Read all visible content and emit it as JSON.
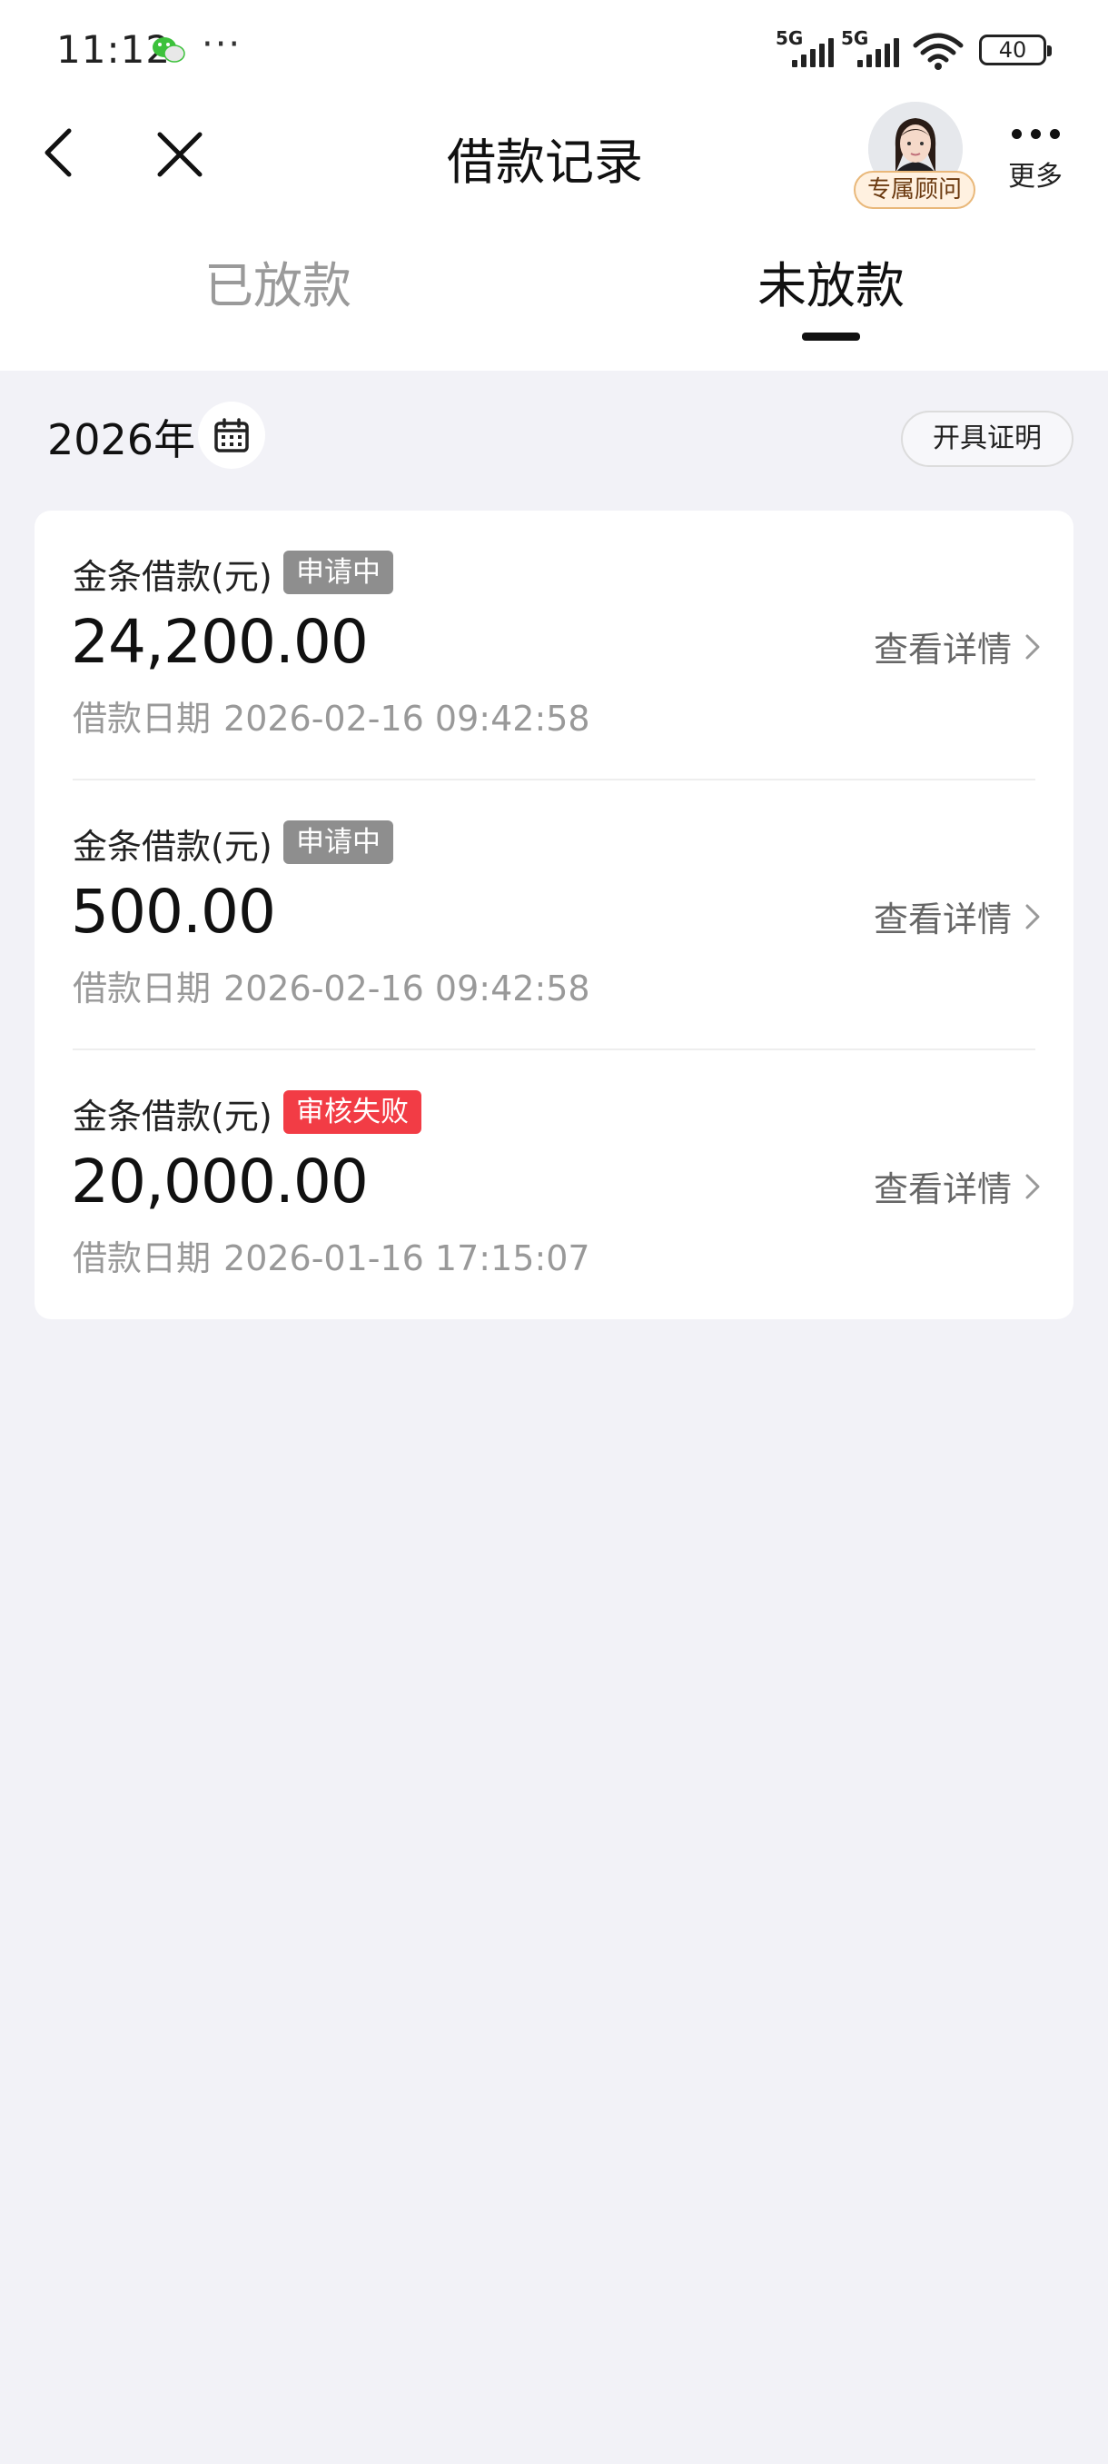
{
  "status_bar": {
    "time": "11:12",
    "more_indicator": "···",
    "network_1": "5G",
    "network_2": "5G",
    "battery": "40",
    "icons": [
      "wechat-icon",
      "signal-icon",
      "wifi-icon",
      "battery-icon"
    ]
  },
  "nav": {
    "title": "借款记录",
    "advisor_label": "专属顾问",
    "more_label": "更多",
    "icons": [
      "back-arrow-icon",
      "close-icon",
      "more-dots-icon"
    ]
  },
  "tabs": [
    {
      "label": "已放款",
      "active": false
    },
    {
      "label": "未放款",
      "active": true
    }
  ],
  "filter": {
    "year": "2026年",
    "certificate_button": "开具证明",
    "icon": "calendar-icon"
  },
  "loans": [
    {
      "product": "金条借款(元)",
      "status": "申请中",
      "status_type": "pending",
      "amount": "24,200.00",
      "date_label": "借款日期",
      "date": "2026-02-16 09:42:58",
      "detail_label": "查看详情"
    },
    {
      "product": "金条借款(元)",
      "status": "申请中",
      "status_type": "pending",
      "amount": "500.00",
      "date_label": "借款日期",
      "date": "2026-02-16 09:42:58",
      "detail_label": "查看详情"
    },
    {
      "product": "金条借款(元)",
      "status": "审核失败",
      "status_type": "failed",
      "amount": "20,000.00",
      "date_label": "借款日期",
      "date": "2026-01-16 17:15:07",
      "detail_label": "查看详情"
    }
  ],
  "colors": {
    "page_background": "#f2f2f7",
    "pending_badge": "#8e8e8e",
    "failed_badge": "#f23c45",
    "active_tab": "#111111",
    "inactive_tab": "#9a9a9a"
  }
}
